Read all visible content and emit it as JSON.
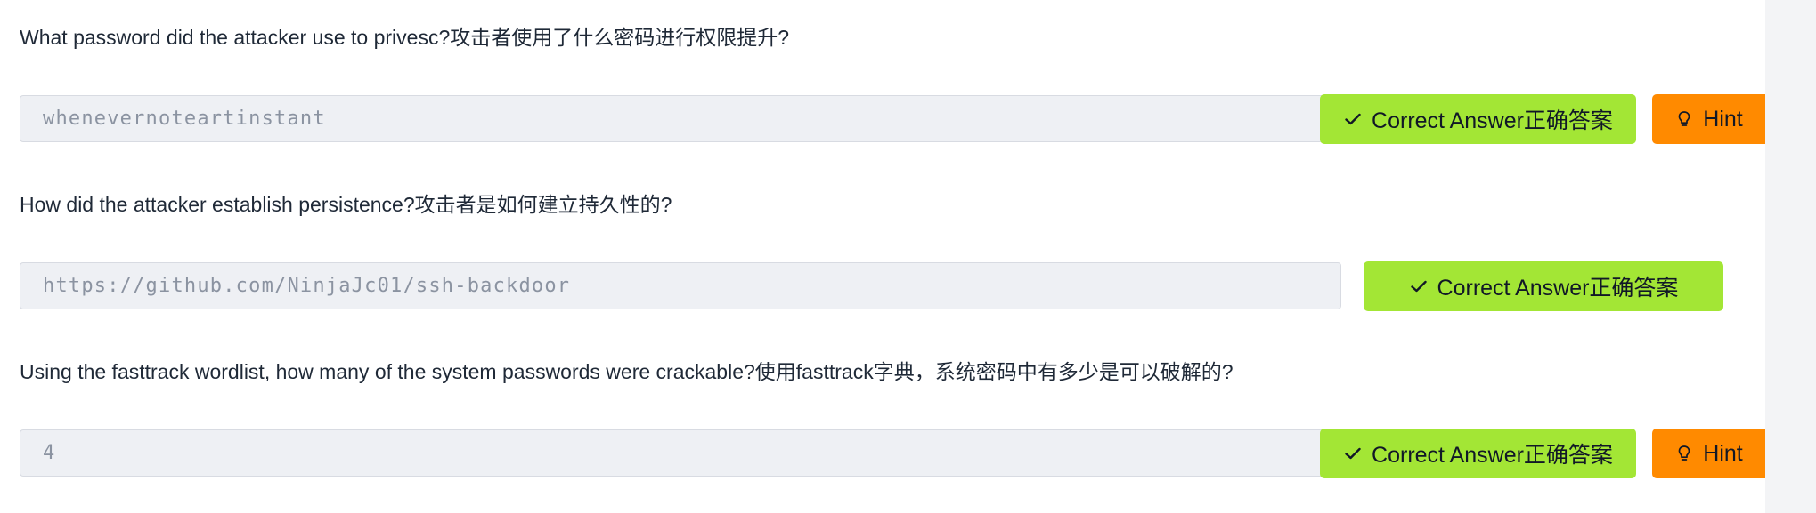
{
  "questions": [
    {
      "text": "What password did the attacker use to privesc?攻击者使用了什么密码进行权限提升?",
      "answer": "whenevernoteartinstant",
      "correct_label": "Correct Answer正确答案",
      "hint_label": "Hint",
      "has_hint": true
    },
    {
      "text": "How did the attacker establish persistence?攻击者是如何建立持久性的?",
      "answer": "https://github.com/NinjaJc01/ssh-backdoor",
      "correct_label": "Correct Answer正确答案",
      "has_hint": false
    },
    {
      "text": "Using the fasttrack wordlist, how many of the system passwords were crackable?使用fasttrack字典，系统密码中有多少是可以破解的?",
      "answer": "4",
      "correct_label": "Correct Answer正确答案",
      "hint_label": "Hint",
      "has_hint": true
    }
  ],
  "colors": {
    "correct_button": "#a3e635",
    "hint_button": "#ff8a00",
    "field_background": "#eef0f4",
    "text": "#1f2937"
  },
  "icons": {
    "correct": "checkmark-icon",
    "hint": "lightbulb-icon"
  }
}
